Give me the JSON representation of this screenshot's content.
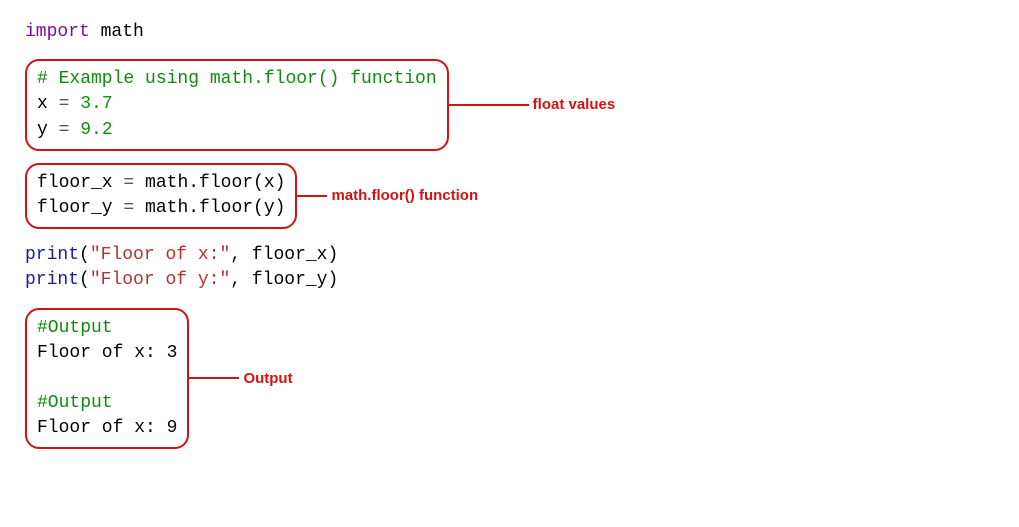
{
  "code": {
    "import_kw": "import",
    "import_mod": " math",
    "block1": {
      "comment": "# Example using math.floor() function",
      "line_x_var": "x ",
      "line_x_op": "=",
      "line_x_val": " 3.7",
      "line_y_var": "y ",
      "line_y_op": "=",
      "line_y_val": " 9.2"
    },
    "block2": {
      "l1_var": "floor_x ",
      "l1_op": "=",
      "l1_rest": " math.floor(x)",
      "l2_var": "floor_y ",
      "l2_op": "=",
      "l2_rest": " math.floor(y)"
    },
    "prints": {
      "p1_fn": "print",
      "p1_open": "(",
      "p1_str": "\"Floor of x:\"",
      "p1_rest": ", floor_x)",
      "p2_fn": "print",
      "p2_open": "(",
      "p2_str": "\"Floor of y:\"",
      "p2_rest": ", floor_y)"
    },
    "output": {
      "c1": "#Output",
      "l1": "Floor of x: 3",
      "c2": "#Output",
      "l2": "Floor of x: 9"
    }
  },
  "labels": {
    "float_values": "float values",
    "math_floor": "math.floor() function",
    "output": "Output"
  },
  "connectors": {
    "w1": 80,
    "w2": 30,
    "w3": 50
  }
}
